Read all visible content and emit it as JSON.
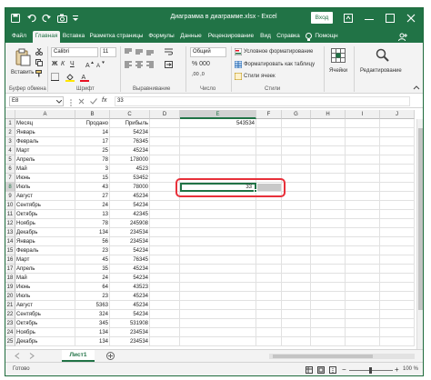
{
  "window": {
    "title": "Диаграмма в диаграмме.xlsx  -  Excel",
    "signin_label": "Вход",
    "accent": "#217346",
    "highlight": "#e8303a"
  },
  "tabs": [
    "Файл",
    "Главная",
    "Вставка",
    "Разметка страницы",
    "Формулы",
    "Данные",
    "Рецензирование",
    "Вид",
    "Справка"
  ],
  "tab_extra": {
    "help_icon_name": "lightbulb-icon",
    "help_label": "Помощн",
    "share_icon_name": "share-icon"
  },
  "ribbon": {
    "clipboard": {
      "paste_label": "Вставить",
      "group_label": "Буфер обмена"
    },
    "font": {
      "name": "Calibri",
      "size": "11",
      "group_label": "Шрифт"
    },
    "alignment": {
      "group_label": "Выравнивание"
    },
    "number": {
      "format": "Общий",
      "group_label": "Число"
    },
    "styles": {
      "conditional": "Условное форматирование",
      "as_table": "Форматировать как таблицу",
      "cell_styles": "Стили ячеек",
      "group_label": "Стили"
    },
    "cells": {
      "label": "Ячейки"
    },
    "editing": {
      "label": "Редактирование"
    }
  },
  "formula_bar": {
    "name_box": "E8",
    "fx": "fx",
    "value": "33"
  },
  "columns": [
    "A",
    "B",
    "C",
    "D",
    "E",
    "F",
    "G",
    "H",
    "I",
    "J"
  ],
  "header_row": {
    "a": "Месяц",
    "b": "Продано",
    "c": "Прибыль",
    "e": "543534"
  },
  "rows": [
    {
      "n": "1"
    },
    {
      "n": "2",
      "a": "Январь",
      "b": "14",
      "c": "54234"
    },
    {
      "n": "3",
      "a": "Февраль",
      "b": "17",
      "c": "76345"
    },
    {
      "n": "4",
      "a": "Март",
      "b": "25",
      "c": "45234"
    },
    {
      "n": "5",
      "a": "Апрель",
      "b": "78",
      "c": "178000"
    },
    {
      "n": "6",
      "a": "Май",
      "b": "3",
      "c": "4523"
    },
    {
      "n": "7",
      "a": "Июнь",
      "b": "15",
      "c": "53452"
    },
    {
      "n": "8",
      "a": "Июль",
      "b": "43",
      "c": "78000"
    },
    {
      "n": "9",
      "a": "Август",
      "b": "27",
      "c": "45234"
    },
    {
      "n": "10",
      "a": "Сентябрь",
      "b": "24",
      "c": "54234"
    },
    {
      "n": "11",
      "a": "Октябрь",
      "b": "13",
      "c": "42345"
    },
    {
      "n": "12",
      "a": "Ноябрь",
      "b": "78",
      "c": "245908"
    },
    {
      "n": "13",
      "a": "Декабрь",
      "b": "134",
      "c": "234534"
    },
    {
      "n": "14",
      "a": "Январь",
      "b": "56",
      "c": "234534"
    },
    {
      "n": "15",
      "a": "Февраль",
      "b": "23",
      "c": "54234"
    },
    {
      "n": "16",
      "a": "Март",
      "b": "45",
      "c": "76345"
    },
    {
      "n": "17",
      "a": "Апрель",
      "b": "35",
      "c": "45234"
    },
    {
      "n": "18",
      "a": "Май",
      "b": "24",
      "c": "54234"
    },
    {
      "n": "19",
      "a": "Июнь",
      "b": "64",
      "c": "43523"
    },
    {
      "n": "20",
      "a": "Июль",
      "b": "23",
      "c": "45234"
    },
    {
      "n": "21",
      "a": "Август",
      "b": "5363",
      "c": "45234"
    },
    {
      "n": "22",
      "a": "Сентябрь",
      "b": "324",
      "c": "54234"
    },
    {
      "n": "23",
      "a": "Октябрь",
      "b": "345",
      "c": "531908"
    },
    {
      "n": "24",
      "a": "Ноябрь",
      "b": "134",
      "c": "234534"
    },
    {
      "n": "25",
      "a": "Декабрь",
      "b": "134",
      "c": "234534"
    }
  ],
  "selected": {
    "ref": "E8",
    "value": "33"
  },
  "sheet": {
    "name": "Лист1"
  },
  "status": {
    "mode": "Готово",
    "zoom": "100 %"
  }
}
